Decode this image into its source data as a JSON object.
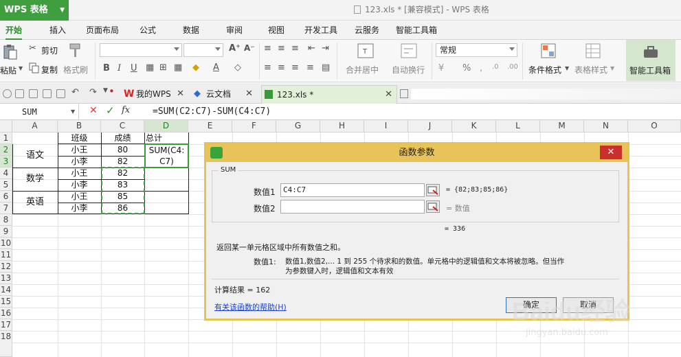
{
  "app": {
    "name": "WPS 表格",
    "window_title": "123.xls * [兼容模式] - WPS 表格"
  },
  "menu": {
    "tabs": [
      "开始",
      "插入",
      "页面布局",
      "公式",
      "数据",
      "审阅",
      "视图",
      "开发工具",
      "云服务",
      "智能工具箱"
    ]
  },
  "ribbon": {
    "paste": "粘贴",
    "cut": "剪切",
    "copy": "复制",
    "format_painter": "格式刷",
    "number_format": "常规",
    "merge_center": "合并居中",
    "auto_wrap": "自动换行",
    "conditional_format": "条件格式",
    "table_style": "表格样式",
    "smart_tools": "智能工具箱",
    "percent": "%",
    "comma": ","
  },
  "doc_tabs": [
    {
      "label": "我的WPS"
    },
    {
      "label": "云文档"
    },
    {
      "label": "123.xls *"
    }
  ],
  "formula_bar": {
    "name_box": "SUM",
    "cancel": "✕",
    "confirm": "✓",
    "fx": "fx",
    "formula": "=SUM(C2:C7)-SUM(C4:C7)"
  },
  "sheet": {
    "columns": [
      "A",
      "B",
      "C",
      "D",
      "E",
      "F",
      "G",
      "H",
      "I",
      "J",
      "K",
      "L",
      "M",
      "N",
      "O"
    ],
    "rows": [
      "1",
      "2",
      "3",
      "4",
      "5",
      "6",
      "7",
      "8",
      "9",
      "10",
      "11",
      "12",
      "13",
      "14",
      "15",
      "16",
      "17",
      "18"
    ],
    "headers": {
      "b1": "班级",
      "c1": "成绩",
      "d1": "总计"
    },
    "subjects": [
      "语文",
      "数学",
      "英语"
    ],
    "students": [
      "小王",
      "小李",
      "小王",
      "小李",
      "小王",
      "小李"
    ],
    "scores": [
      "80",
      "82",
      "82",
      "83",
      "85",
      "86"
    ],
    "editing": {
      "line1": "SUM(C4:",
      "line2": "C7)"
    }
  },
  "dialog": {
    "title": "函数参数",
    "function_name": "SUM",
    "arg1_label": "数值1",
    "arg1_value": "C4:C7",
    "arg1_result": "= {82;83;85;86}",
    "arg2_label": "数值2",
    "arg2_value": "",
    "arg2_result": "= 数值",
    "total": "= 336",
    "description": "返回某一单元格区域中所有数值之和。",
    "arg_help_label": "数值1:",
    "arg_help_line1": "数值1,数值2,... 1 到 255 个待求和的数值。单元格中的逻辑值和文本将被忽略。但当作",
    "arg_help_line2": "为参数键入时，逻辑值和文本有效",
    "calc_result_label": "计算结果 = 162",
    "help_link": "有关该函数的帮助(H)",
    "ok": "确定",
    "cancel": "取消"
  },
  "watermark": {
    "text": "Baidu经验",
    "url": "jingyan.baidu.com"
  },
  "colors": {
    "accent": "#3f9f3f",
    "dialog_border": "#e5c34f",
    "selection_dash": "#3c9a3c"
  }
}
